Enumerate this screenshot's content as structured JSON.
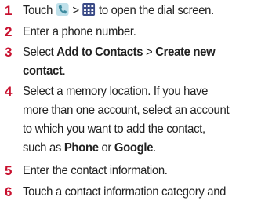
{
  "colors": {
    "number": "#c8102e",
    "phone_icon_bg": "#bfe0ea",
    "grid_icon_bg": "#3a4a86"
  },
  "icons": {
    "phone": "phone-icon",
    "dialpad": "dialpad-grid-icon"
  },
  "steps": [
    {
      "num": "1",
      "t1": "Touch ",
      "sep": " > ",
      "t2": " to open the dial screen."
    },
    {
      "num": "2",
      "t1": "Enter a phone number."
    },
    {
      "num": "3",
      "t1": "Select ",
      "b1": "Add to Contacts",
      "t2": " > ",
      "b2": "Create new",
      "b3": "contact",
      "t3": "."
    },
    {
      "num": "4",
      "t1": "Select a memory location. If you have",
      "t2": "more than one account, select an account",
      "t3": "to which you want to add the contact,",
      "t4": "such as ",
      "b1": "Phone",
      "t5": " or ",
      "b2": "Google",
      "t6": "."
    },
    {
      "num": "5",
      "t1": "Enter the contact information."
    },
    {
      "num": "6",
      "t1": "Touch a contact information category and"
    }
  ]
}
